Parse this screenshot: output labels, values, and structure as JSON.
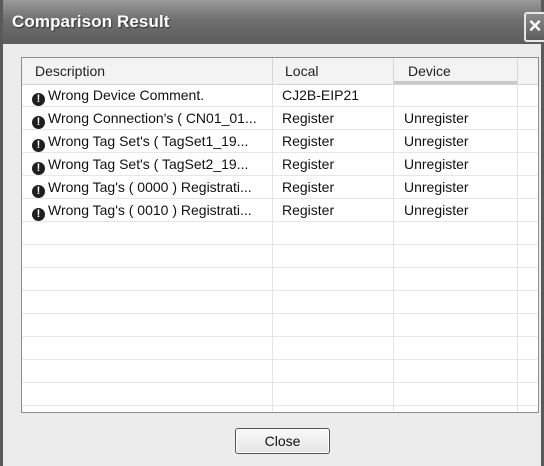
{
  "window": {
    "title": "Comparison Result",
    "close_glyph": "×"
  },
  "columns": [
    {
      "label": "Description"
    },
    {
      "label": "Local"
    },
    {
      "label": "Device"
    }
  ],
  "rows": [
    {
      "icon": "warning-icon",
      "description": "Wrong Device Comment.",
      "local": "CJ2B-EIP21",
      "device": ""
    },
    {
      "icon": "warning-icon",
      "description": "Wrong Connection's ( CN01_01...",
      "local": "Register",
      "device": "Unregister"
    },
    {
      "icon": "warning-icon",
      "description": "Wrong Tag Set's ( TagSet1_19...",
      "local": "Register",
      "device": "Unregister"
    },
    {
      "icon": "warning-icon",
      "description": "Wrong Tag Set's ( TagSet2_19...",
      "local": "Register",
      "device": "Unregister"
    },
    {
      "icon": "warning-icon",
      "description": "Wrong Tag's ( 0000 ) Registrati...",
      "local": "Register",
      "device": "Unregister"
    },
    {
      "icon": "warning-icon",
      "description": "Wrong Tag's ( 0010 ) Registrati...",
      "local": "Register",
      "device": "Unregister"
    }
  ],
  "buttons": {
    "close_label": "Close"
  }
}
